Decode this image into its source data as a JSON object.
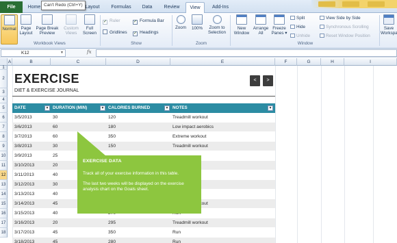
{
  "ribbon_tabs": [
    {
      "label": "File"
    },
    {
      "label": "Home"
    },
    {
      "label": "Layout"
    },
    {
      "label": "Formulas"
    },
    {
      "label": "Data"
    },
    {
      "label": "Review"
    },
    {
      "label": "View"
    },
    {
      "label": "Add-Ins"
    }
  ],
  "tooltip": "Can't Redo (Ctrl+Y)",
  "workbook_views": {
    "group_label": "Workbook Views",
    "buttons": [
      "Normal",
      "Page Layout",
      "Page Break Preview",
      "Custom Views",
      "Full Screen"
    ]
  },
  "show": {
    "group_label": "Show",
    "ruler": "Ruler",
    "formula_bar": "Formula Bar",
    "gridlines": "Gridlines",
    "headings": "Headings"
  },
  "zoom": {
    "group_label": "Zoom",
    "buttons": [
      "Zoom",
      "100%",
      "Zoom to Selection"
    ]
  },
  "window": {
    "group_label": "Window",
    "new_window": "New Window",
    "arrange_all": "Arrange All",
    "freeze_panes": "Freeze Panes",
    "split": "Split",
    "hide": "Hide",
    "unhide": "Unhide",
    "view_side_by_side": "View Side by Side",
    "synchronous_scrolling": "Synchronous Scrolling",
    "reset_window_position": "Reset Window Position",
    "save_workspace": "Save Workspa..."
  },
  "formula_bar": {
    "name_box": "K12",
    "fx": "fx",
    "value": ""
  },
  "columns": [
    "A",
    "B",
    "C",
    "D",
    "E",
    "F",
    "G",
    "H",
    "I"
  ],
  "rows": [
    "1",
    "2",
    "3",
    "4",
    "5",
    "6",
    "7",
    "8",
    "9",
    "10",
    "11",
    "12",
    "13",
    "14",
    "15",
    "16",
    "17",
    "18"
  ],
  "selected_row": "12",
  "sheet": {
    "title": "EXERCISE",
    "subtitle": "DIET & EXERCISE JOURNAL",
    "prev_button": "<",
    "next_button": ">"
  },
  "table": {
    "headers": [
      "DATE",
      "DURATION (MIN)",
      "CALORIES BURNED",
      "NOTES"
    ],
    "rows": [
      [
        "3/5/2013",
        "30",
        "120",
        "Treadmill workout"
      ],
      [
        "3/6/2013",
        "60",
        "180",
        "Low impact aerobics"
      ],
      [
        "3/7/2013",
        "60",
        "350",
        "Extreme workout"
      ],
      [
        "3/8/2013",
        "30",
        "150",
        "Treadmill workout"
      ],
      [
        "3/9/2013",
        "25",
        "",
        ""
      ],
      [
        "3/10/2013",
        "20",
        "",
        "kout"
      ],
      [
        "3/11/2013",
        "40",
        "",
        ""
      ],
      [
        "3/12/2013",
        "30",
        "",
        ""
      ],
      [
        "3/13/2013",
        "40",
        "",
        ""
      ],
      [
        "3/14/2013",
        "45",
        "325",
        "Treadmill workout"
      ],
      [
        "3/15/2013",
        "40",
        "270",
        "Run"
      ],
      [
        "3/16/2013",
        "20",
        "295",
        "Treadmill workout"
      ],
      [
        "3/17/2013",
        "45",
        "350",
        "Run"
      ],
      [
        "3/18/2013",
        "45",
        "280",
        "Run"
      ]
    ]
  },
  "callout": {
    "title": "EXERCISE DATA",
    "line1": "Track all of your exercise information in this table.",
    "line2": "The last two weeks will be displayed on the exercise analysis chart on the Goals sheet."
  },
  "colors": {
    "file_tab": "#2a6f34",
    "table_header": "#2c8ca3",
    "callout": "#8dc63f",
    "active_button": "#f7c75a"
  }
}
